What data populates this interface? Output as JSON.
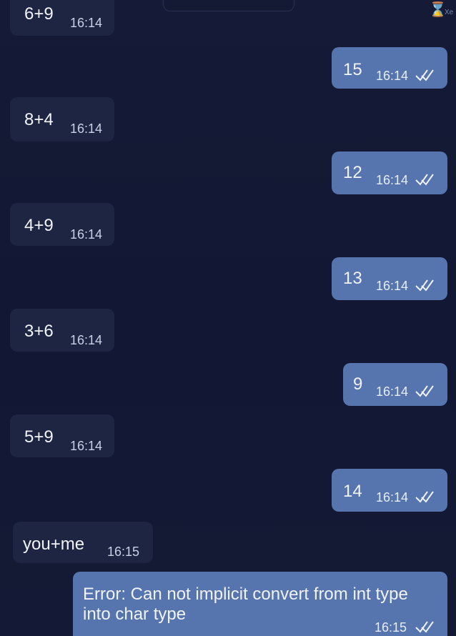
{
  "app": {
    "icon": "hourglass-icon",
    "corner_label": "Xe"
  },
  "messages": [
    {
      "from": "other",
      "text": "6+9",
      "time": "16:14"
    },
    {
      "from": "me",
      "text": "15",
      "time": "16:14",
      "status": "double-check"
    },
    {
      "from": "other",
      "text": "8+4",
      "time": "16:14"
    },
    {
      "from": "me",
      "text": "12",
      "time": "16:14",
      "status": "double-check"
    },
    {
      "from": "other",
      "text": "4+9",
      "time": "16:14"
    },
    {
      "from": "me",
      "text": "13",
      "time": "16:14",
      "status": "double-check"
    },
    {
      "from": "other",
      "text": "3+6",
      "time": "16:14"
    },
    {
      "from": "me",
      "text": "9",
      "time": "16:14",
      "status": "double-check"
    },
    {
      "from": "other",
      "text": "5+9",
      "time": "16:14"
    },
    {
      "from": "me",
      "text": "14",
      "time": "16:14",
      "status": "double-check"
    },
    {
      "from": "other",
      "text": "you+me",
      "time": "16:15"
    },
    {
      "from": "me",
      "text": "Error: Can not implicit convert from int type into char type",
      "time": "16:15",
      "status": "double-check"
    }
  ],
  "colors": {
    "background": "#141a33",
    "incoming_bubble": "#1d2542",
    "outgoing_bubble": "#5674ae",
    "text": "#f1f3f8"
  }
}
